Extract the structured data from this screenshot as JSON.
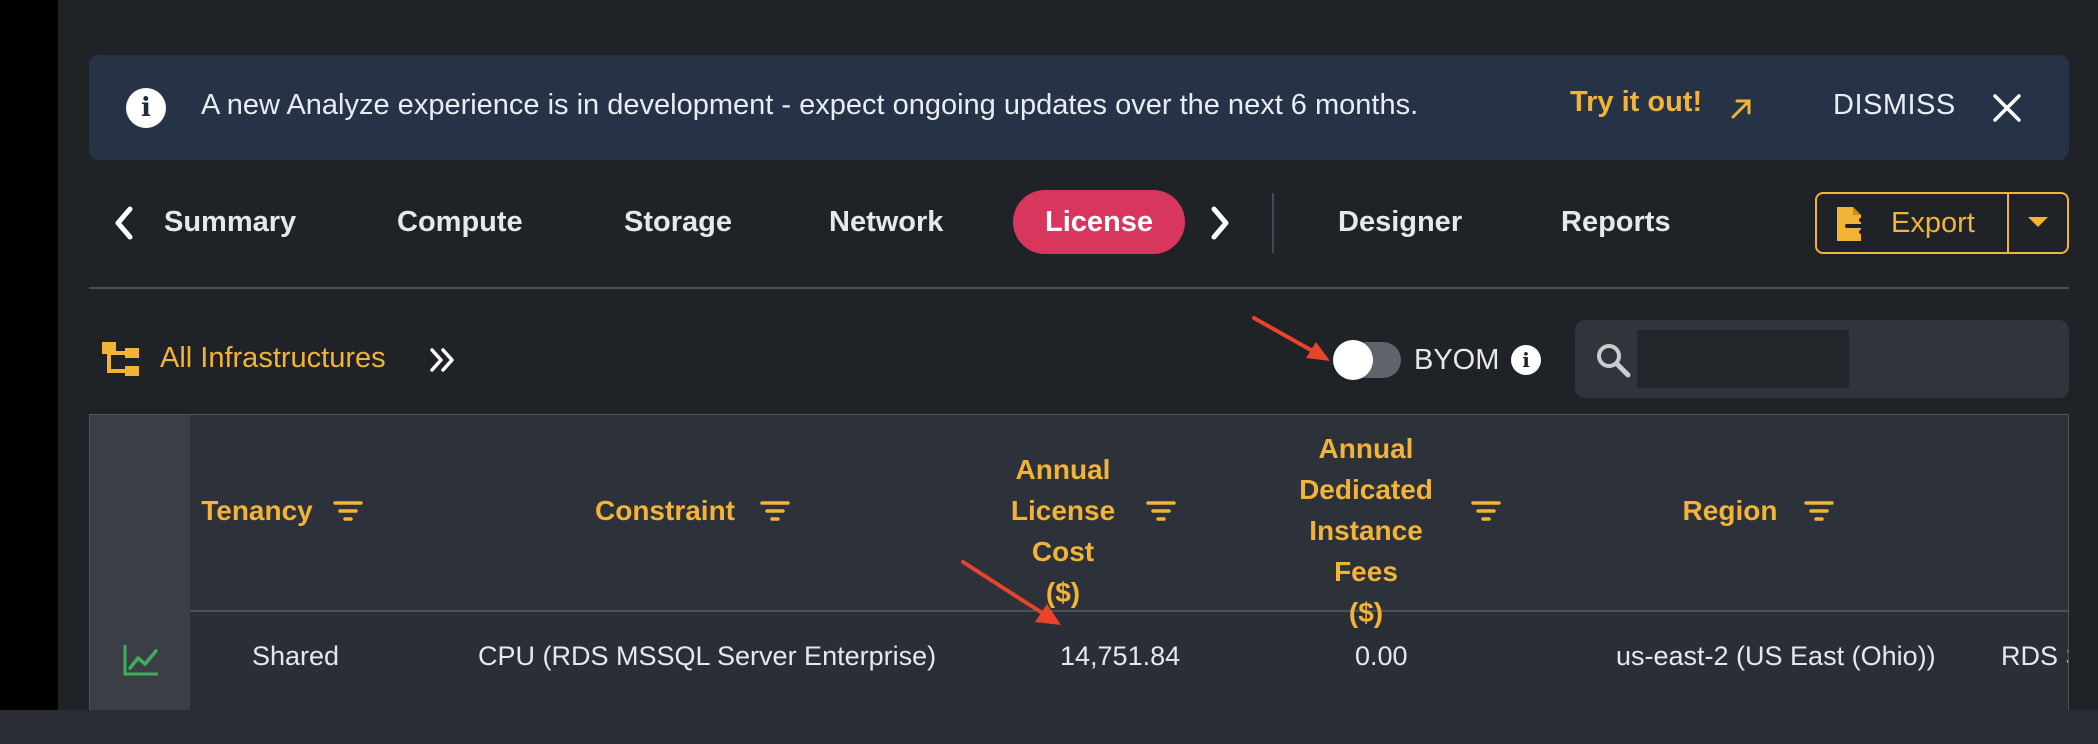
{
  "banner": {
    "message": "A new Analyze experience is in development - expect ongoing updates over the next 6 months.",
    "try_link": "Try it out!",
    "dismiss": "DISMISS",
    "info_icon": "info-icon",
    "external_icon": "external-link-icon",
    "close_icon": "close-icon"
  },
  "tabs": [
    {
      "label": "Summary"
    },
    {
      "label": "Compute"
    },
    {
      "label": "Storage"
    },
    {
      "label": "Network"
    },
    {
      "label": "License",
      "active": true
    },
    {
      "label": "Designer"
    },
    {
      "label": "Reports"
    }
  ],
  "export": {
    "label": "Export"
  },
  "toolbar": {
    "infrastructure_label": "All Infrastructures",
    "byom_label": "BYOM",
    "byom_on": false,
    "search_value": ""
  },
  "table": {
    "columns": [
      {
        "label": "Tenancy"
      },
      {
        "label": "Constraint"
      },
      {
        "label": "Annual License Cost ($)"
      },
      {
        "label": "Annual Dedicated Instance Fees ($)"
      },
      {
        "label": "Region"
      }
    ],
    "rows": [
      {
        "tenancy": "Shared",
        "constraint": "CPU (RDS MSSQL Server Enterprise)",
        "annual_license_cost": "14,751.84",
        "dedicated_fees": "0.00",
        "region": "us-east-2 (US East (Ohio))",
        "overflow": "RDS S"
      }
    ]
  },
  "colors": {
    "accent": "#f2b336",
    "active_tab": "#d9365e",
    "banner_bg": "#263246",
    "annotation": "#e8432b"
  }
}
